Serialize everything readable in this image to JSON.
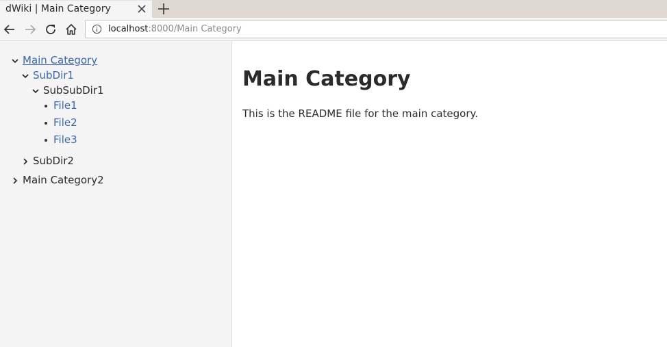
{
  "browser": {
    "tab_title": "dWiki | Main Category",
    "url_host": "localhost",
    "url_rest": ":8000/Main Category"
  },
  "sidebar": {
    "tree": [
      {
        "label": "Main Category",
        "state": "expanded",
        "style": "active-link"
      },
      {
        "label": "SubDir1",
        "state": "expanded",
        "style": "link"
      },
      {
        "label": "SubSubDir1",
        "state": "expanded",
        "style": "plain"
      },
      {
        "label": "File1",
        "state": "leaf",
        "style": "link"
      },
      {
        "label": "File2",
        "state": "leaf",
        "style": "link"
      },
      {
        "label": "File3",
        "state": "leaf",
        "style": "link"
      },
      {
        "label": "SubDir2",
        "state": "collapsed",
        "style": "plain"
      },
      {
        "label": "Main Category2",
        "state": "collapsed",
        "style": "plain"
      }
    ]
  },
  "main": {
    "title": "Main Category",
    "body": "This is the README file for the main category."
  },
  "colors": {
    "link": "#3b67ad",
    "sidebar_bg": "#f4f4f4",
    "text": "#2b2b2b"
  }
}
